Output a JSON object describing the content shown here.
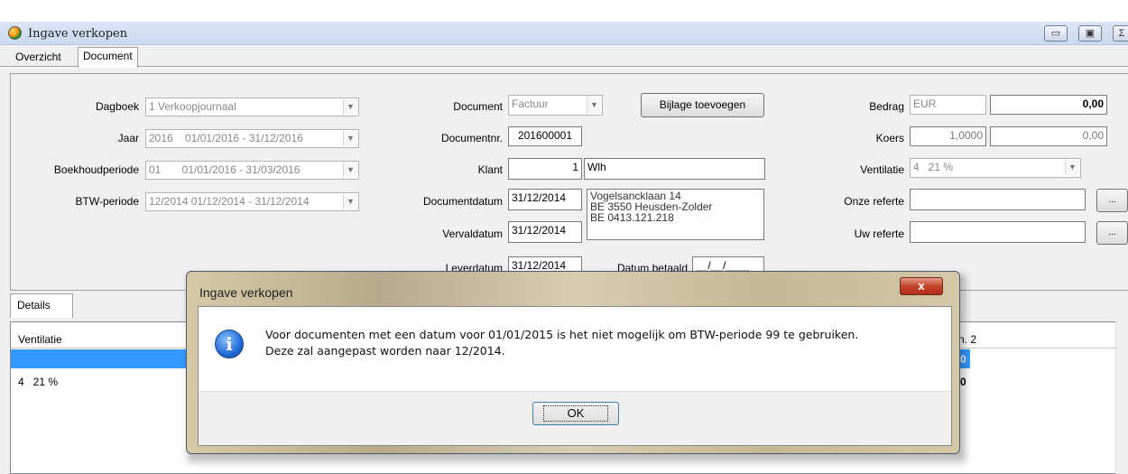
{
  "window": {
    "title": "Ingave verkopen"
  },
  "tabs": [
    "Overzicht",
    "Document"
  ],
  "form": {
    "dagboek": {
      "label": "Dagboek",
      "value": "1 Verkoopjournaal"
    },
    "jaar": {
      "label": "Jaar",
      "value": "2016    01/01/2016 - 31/12/2016"
    },
    "boekhoudperiode": {
      "label": "Boekhoudperiode",
      "value": "01       01/01/2016 - 31/03/2016"
    },
    "btw_periode": {
      "label": "BTW-periode",
      "value": "12/2014 01/12/2014 - 31/12/2014"
    },
    "document": {
      "label": "Document",
      "value": "Factuur"
    },
    "bijlage_button": "Bijlage toevoegen",
    "documentnr": {
      "label": "Documentnr.",
      "value": "201600001"
    },
    "klant": {
      "label": "Klant",
      "value": "1",
      "name": "Wlh"
    },
    "documentdatum": {
      "label": "Documentdatum",
      "value": "31/12/2014"
    },
    "vervaldatum": {
      "label": "Vervaldatum",
      "value": "31/12/2014"
    },
    "leverdatum": {
      "label": "Leverdatum",
      "value": "31/12/2014"
    },
    "datum_betaald": {
      "label": "Datum betaald",
      "value": "__/__/____"
    },
    "address": {
      "line1": "Vogelsancklaan 14",
      "line2": "BE 3550 Heusden-Zolder",
      "line3": "BE 0413.121.218"
    },
    "bedrag": {
      "label": "Bedrag",
      "currency": "EUR",
      "value": "0,00"
    },
    "koers": {
      "label": "Koers",
      "rate": "1,0000",
      "value": "0,00"
    },
    "ventilatie": {
      "label": "Ventilatie",
      "value": "4   21 %"
    },
    "onze_referte": {
      "label": "Onze referte",
      "value": ""
    },
    "uw_referte": {
      "label": "Uw referte",
      "value": ""
    },
    "ellipsis": "..."
  },
  "details": {
    "tab_label": "Details",
    "column_ventilatie": "Ventilatie",
    "column_right": "n. 2",
    "rows": [
      {
        "ventilatie": "",
        "right": "0"
      },
      {
        "ventilatie": "4   21 %",
        "right": "0"
      }
    ]
  },
  "dialog": {
    "title": "Ingave verkopen",
    "close": "x",
    "message_line1": "Voor documenten met een datum voor 01/01/2015 is het niet mogelijk om BTW-periode 99 te gebruiken.",
    "message_line2": "Deze zal aangepast worden naar 12/2014.",
    "ok_label": "OK",
    "icon": "information-icon"
  },
  "window_buttons": {
    "minimize": "▭",
    "restore": "▣",
    "close": "Σ"
  }
}
